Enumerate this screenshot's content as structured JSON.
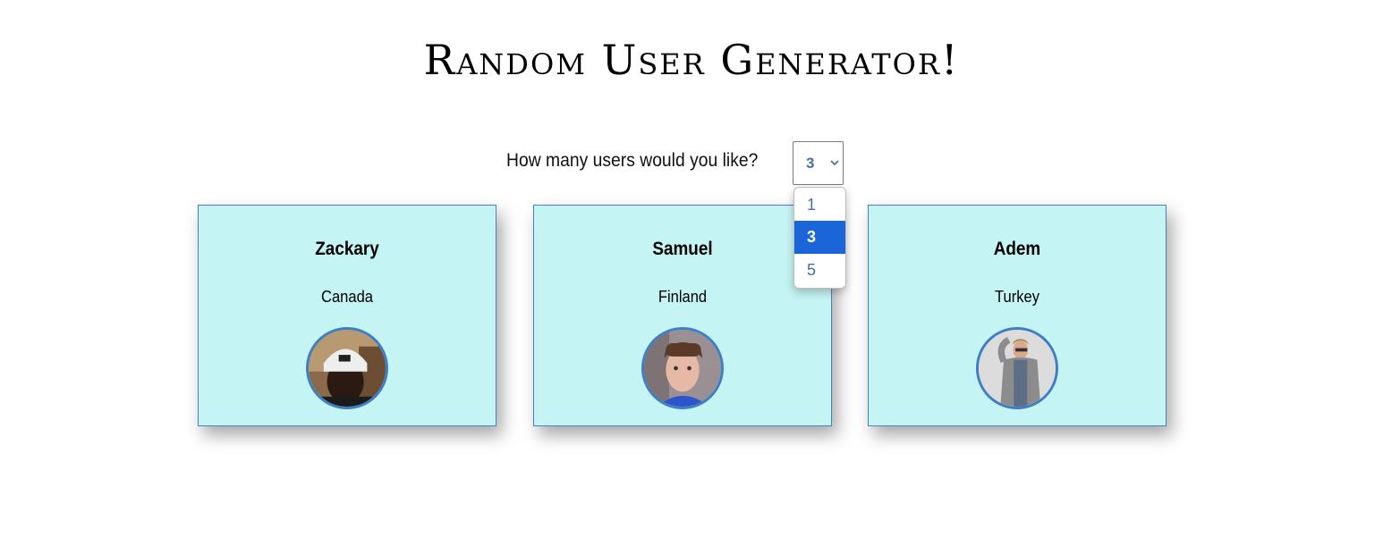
{
  "header": {
    "title": "Random User Generator!"
  },
  "controls": {
    "prompt": "How many users would you like?",
    "selected": "3",
    "options": [
      "1",
      "3",
      "5"
    ]
  },
  "users": [
    {
      "name": "Zackary",
      "country": "Canada"
    },
    {
      "name": "Samuel",
      "country": "Finland"
    },
    {
      "name": "Adem",
      "country": "Turkey"
    }
  ],
  "colors": {
    "card_background": "#c5f4f4",
    "card_border": "#4a7fc2",
    "selected_option": "#1a66d9"
  }
}
